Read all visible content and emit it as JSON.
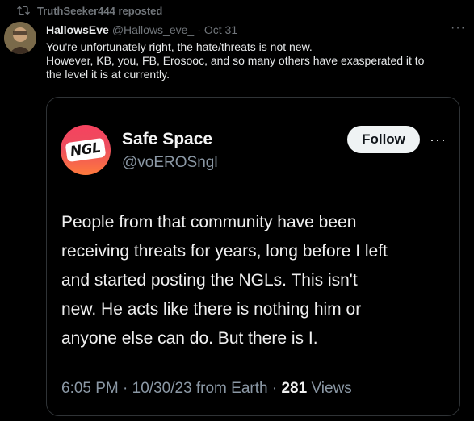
{
  "repost": {
    "label": "TruthSeeker444 reposted"
  },
  "tweet": {
    "author_name": "HallowsEve",
    "author_handle": "@Hallows_eve_",
    "separator": "·",
    "date": "Oct 31",
    "lines": [
      "You're unfortunately right, the hate/threats is not new.",
      "However, KB, you, FB, Erosooc, and so many others have exasperated it to",
      "the level it is at currently."
    ],
    "more_icon": "more-horizontal-icon"
  },
  "embedded": {
    "avatar_text": "NGL",
    "name": "Safe Space",
    "handle": "@voEROSngl",
    "follow_label": "Follow",
    "more_icon": "more-horizontal-icon",
    "lines": [
      "People from that community have been",
      "receiving threats for years, long before I left",
      "and started posting the NGLs. This isn't",
      "new. He acts like there is nothing him or",
      "anyone else can do. But there is I."
    ],
    "meta_time": "6:05 PM · 10/30/23 from Earth · ",
    "meta_views_count": "281",
    "meta_views_label": " Views"
  },
  "colors": {
    "background": "#000000",
    "text": "#e7e9ea",
    "muted": "#71767b",
    "border": "#2f3336"
  }
}
